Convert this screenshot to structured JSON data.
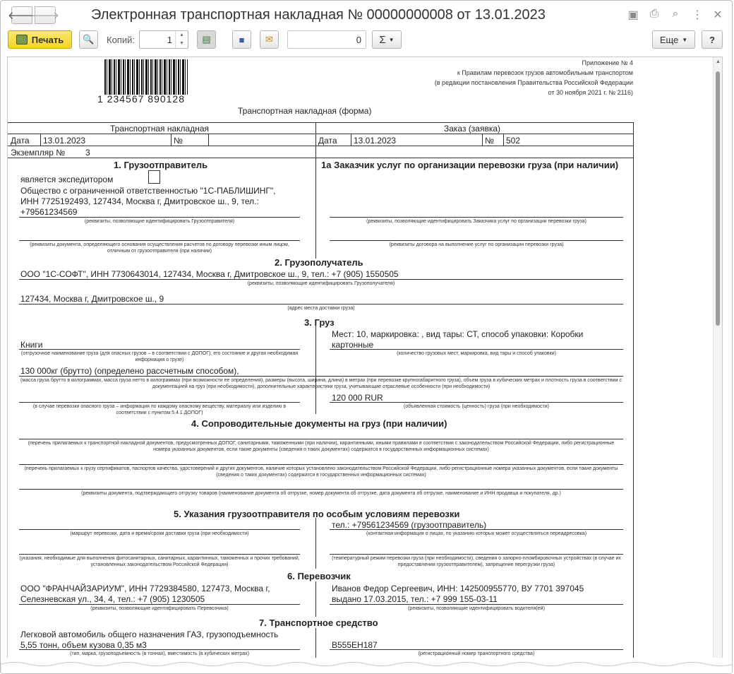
{
  "window": {
    "title": "Электронная транспортная накладная № 00000000008 от 13.01.2023"
  },
  "toolbar": {
    "print": "Печать",
    "copies_label": "Копий:",
    "copies_value": "1",
    "sum_value": "0",
    "sigma": "Σ",
    "more": "Еще",
    "help": "?"
  },
  "doc": {
    "appendix": [
      "Приложение № 4",
      "к Правилам перевозок грузов автомобильным транспортом",
      "(в редакции постановления Правительства Российской Федерации",
      "от 30 ноября 2021 г. № 2116)"
    ],
    "barcode_number": "1 234567 890128",
    "form_title": "Транспортная накладная (форма)",
    "tn_header": "Транспортная накладная",
    "order_header": "Заказ (заявка)",
    "date_label": "Дата",
    "date_value": "13.01.2023",
    "no_label": "№",
    "order_date_label": "Дата",
    "order_date_value": "13.01.2023",
    "order_no_label": "№",
    "order_no_value": "502",
    "copy_label": "Экземпляр №",
    "copy_value": "3",
    "s1_title": "1. Грузоотправитель",
    "s1_expeditor": "является экспедитором",
    "s1_text1": "Общество с ограниченной ответственностью \"1С-ПАБЛИШИНГ\",",
    "s1_text2": "ИНН 7725192493, 127434, Москва г, Дмитровское ш., 9, тел.:",
    "s1_text3": "+79561234569",
    "s1_cap1": "(реквизиты, позволяющие идентифицировать Грузоотправителя)",
    "s1_cap2": "(реквизиты документа, определяющего основания осуществления расчетов по договору перевозки иным лицом, отличным от грузоотправителя (при наличии)",
    "s1a_title": "1а Заказчик услуг по организации перевозки груза (при наличии)",
    "s1a_cap1": "(реквизиты, позволяющие идентифицировать Заказчика услуг по организации перевозки груза)",
    "s1a_cap2": "(реквизиты договора на выполнение услуг по организации перевозки груза)",
    "s2_title": "2. Грузополучатель",
    "s2_text": "ООО \"1С-СОФТ\", ИНН 7730643014, 127434, Москва г, Дмитровское ш., 9, тел.: +7 (905) 1550505",
    "s2_cap1": "(реквизиты, позволяющие идентифицировать Грузополучателя)",
    "s2_addr": "127434, Москва г, Дмитровское ш., 9",
    "s2_cap2": "(адрес места доставки груза)",
    "s3_title": "3. Груз",
    "s3_name": "Книги",
    "s3_cap_name": "(отгрузочное наименование груза (для опасных грузов – в соответствии с ДОПОГ), его состояние и другая необходимая информация о грузе)",
    "s3_places1": "Мест: 10, маркировка: , вид тары: СТ, способ упаковки: Коробки",
    "s3_places2": "картонные",
    "s3_cap_places": "(количество грузовых мест, маркировка, вид тары и способ упаковки)",
    "s3_mass": "130 000кг (брутто) (определено рассчетным способом),",
    "s3_cap_mass": "(масса груза брутто в килограммах, масса груза нетто в килограммах (при возможности ее определения), размеры (высота, ширина, длина) в метрах (при перевозке крупногабаритного груза), объем груза в кубических метрах и плотность груза в соответствии с документацией на груз (при необходимости), дополнительные характеристики груза, учитывающие отраслевые особенности (при необходимости)",
    "s3_cap_danger": "(в случае перевозки опасного груза – информация по каждому опасному веществу, материалу или изделию в соответствии с пунктом 5.4.1 ДОПОГ)",
    "s3_value": "120 000 RUR",
    "s3_cap_value": "(объявленная стоимость (ценность) груза (при необходимости)",
    "s4_title": "4. Сопроводительные документы на груз (при наличии)",
    "s4_cap1": "(перечень прилагаемых к транспортной накладной документов, предусмотренных ДОПОГ, санитарными, таможенными (при наличии), карантинными, иными правилами в соответствии с законодательством Российской Федерации, либо регистрационные номера указанных документов, если такие документы (сведения о таких документах) содержатся в государственных информационных системах)",
    "s4_cap2": "(перечень прилагаемых к грузу сертификатов, паспортов качества, удостоверений и других документов, наличие которых установлено законодательством Российской Федерации, либо регистрационные номера указанных документов, если такие документы (сведения о таких документах) содержатся в государственных информационных системах)",
    "s4_cap3": "(реквизиты документа, подтверждающего отгрузку товаров (наименование документа об отгрузке, номер документа об отгрузке, дата документа об отгрузке, наименование и ИНН продавца и покупателя, др.)",
    "s5_title": "5. Указания грузоотправителя по особым условиям перевозки",
    "s5_contact": "тел.: +79561234569 (грузоотправитель)",
    "s5_cap1": "(маршрут перевозки, дата и время/сроки доставки груза (при необходимости)",
    "s5_cap2": "(контактная информация о лицах, по указанию которых может осуществляться переадресовка)",
    "s5_cap3": "(указания, необходимые для выполнения фитосанитарных, санитарных, карантинных, таможенных и прочих требований, установленных законодательством Российской Федерации)",
    "s5_cap4": "(температурный режим перевозки груза (при необходимости), сведения о запорно-пломбировочных устройствах (в случае их предоставления грузоотправителем), запрещение перегрузки груза)",
    "s6_title": "6. Перевозчик",
    "s6_left1": "ООО \"ФРАНЧАЙЗАРИУМ\", ИНН 7729384580, 127473, Москва г,",
    "s6_left2": "Селезневская ул., 34, 4, тел.: +7 (905) 1230505",
    "s6_cap1": "(реквизиты, позволяющие идентифицировать Перевозчика)",
    "s6_right1": "Иванов Федор Сергеевич, ИНН: 142500955770, ВУ 7701 397045",
    "s6_right2": "выдано 17.03.2015, тел.: +7 999 155-03-11",
    "s6_cap2": "(реквизиты, позволяющие идентифицировать водителя(ей)",
    "s7_title": "7. Транспортное средство",
    "s7_left1": "Легковой автомобиль общего назначения ГАЗ, грузоподъемность",
    "s7_left2": "5,55 тонн, объем кузова 0,35 м3",
    "s7_cap1": "(тип, марка, грузоподъемность (в тоннах), вместимость (в кубических метрах)",
    "s7_right": "В555ЕН187",
    "s7_cap2": "(регистрационный номер транспортного средства)"
  }
}
